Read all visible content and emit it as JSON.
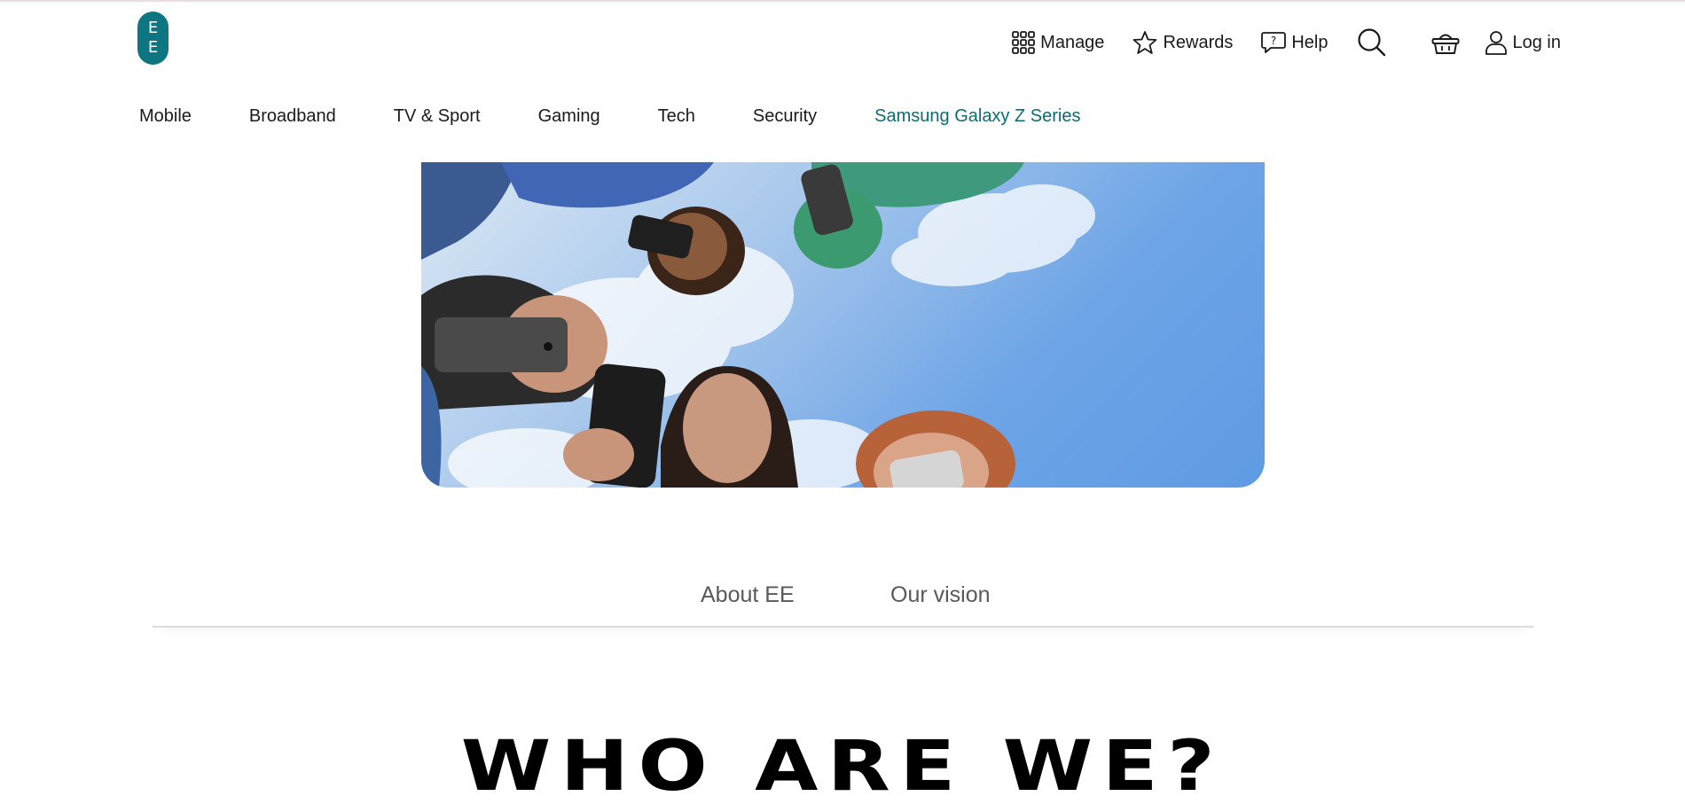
{
  "brand": {
    "logo_letters": [
      "E",
      "E"
    ],
    "color": "#0d7680"
  },
  "utility_nav": {
    "manage": "Manage",
    "rewards": "Rewards",
    "help": "Help",
    "login": "Log in",
    "icons": [
      "grid-icon",
      "star-icon",
      "help-bubble-icon",
      "search-icon",
      "basket-icon",
      "user-icon"
    ]
  },
  "main_nav": {
    "items": [
      {
        "label": "Mobile"
      },
      {
        "label": "Broadband"
      },
      {
        "label": "TV & Sport"
      },
      {
        "label": "Gaming"
      },
      {
        "label": "Tech"
      },
      {
        "label": "Security"
      },
      {
        "label": "Samsung Galaxy Z Series",
        "active": true,
        "color": "#0d6b73"
      }
    ]
  },
  "tabs": {
    "items": [
      {
        "label": "About EE"
      },
      {
        "label": "Our vision"
      }
    ]
  },
  "section": {
    "heading": "WHO ARE WE?"
  }
}
